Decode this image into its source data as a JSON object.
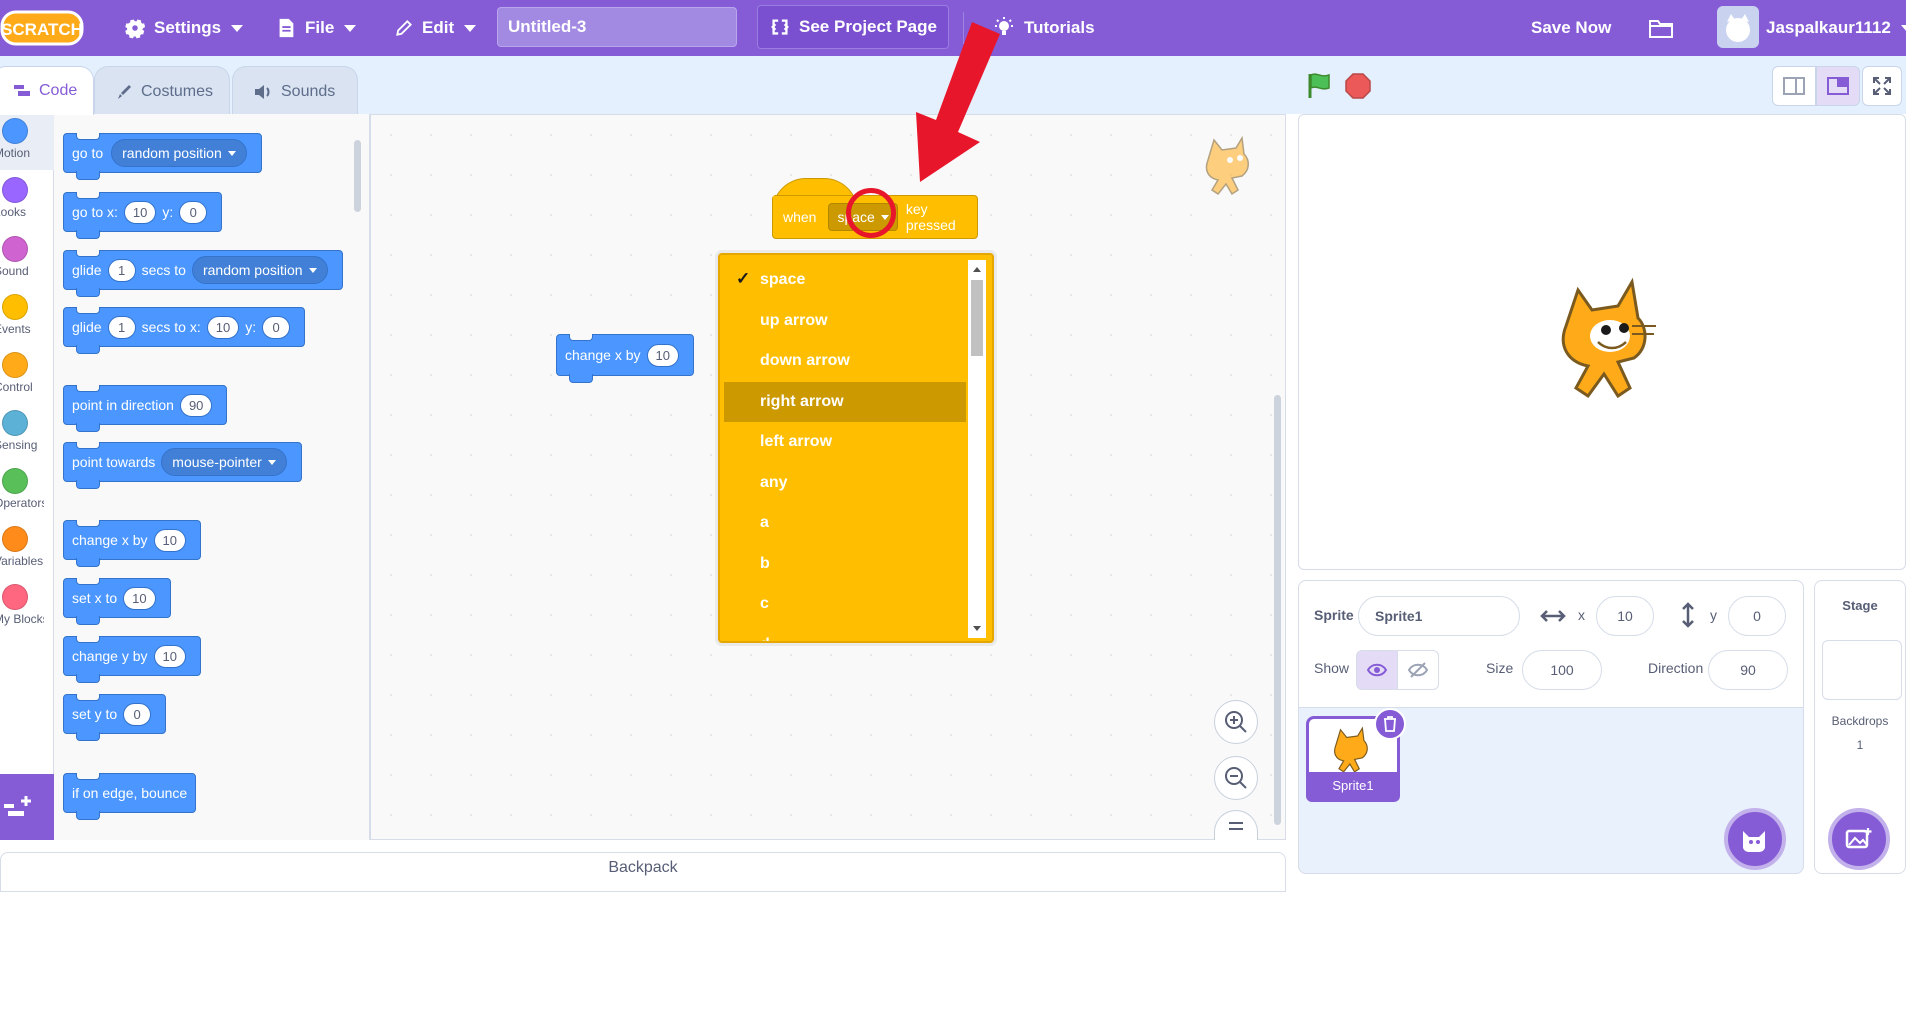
{
  "menubar": {
    "logo_text": "SCRATCH",
    "settings_label": "Settings",
    "file_label": "File",
    "edit_label": "Edit",
    "project_title": "Untitled-3",
    "see_project_label": "See Project Page",
    "tutorials_label": "Tutorials",
    "save_now_label": "Save Now",
    "username": "Jaspalkaur1112"
  },
  "tabs": [
    {
      "label": "Code"
    },
    {
      "label": "Costumes"
    },
    {
      "label": "Sounds"
    }
  ],
  "categories": [
    {
      "label": "Motion",
      "color": "#4c97ff"
    },
    {
      "label": "Looks",
      "color": "#9966ff"
    },
    {
      "label": "Sound",
      "color": "#cf63cf"
    },
    {
      "label": "Events",
      "color": "#ffbf00"
    },
    {
      "label": "Control",
      "color": "#ffab19"
    },
    {
      "label": "Sensing",
      "color": "#5cb1d6"
    },
    {
      "label": "Operators",
      "color": "#59c059"
    },
    {
      "label": "Variables",
      "color": "#ff8c1a"
    },
    {
      "label": "My Blocks",
      "color": "#ff6680"
    }
  ],
  "palette": {
    "goto_label": "go to",
    "goto_drop": "random position",
    "gotoxy_label": "go to x:",
    "gotoxy_x": "10",
    "gotoxy_ylabel": "y:",
    "gotoxy_y": "0",
    "glide_label": "glide",
    "glide_secs": "1",
    "glide_secs_to": "secs to",
    "glide_drop": "random position",
    "glidexy_label": "glide",
    "glidexy_secs": "1",
    "glidexy_secs_to": "secs to x:",
    "glidexy_x": "10",
    "glidexy_ylabel": "y:",
    "glidexy_y": "0",
    "point_dir_label": "point in direction",
    "point_dir_val": "90",
    "point_towards_label": "point towards",
    "point_towards_drop": "mouse-pointer",
    "change_x_label": "change x by",
    "change_x_val": "10",
    "set_x_label": "set x to",
    "set_x_val": "10",
    "change_y_label": "change y by",
    "change_y_val": "10",
    "set_y_label": "set y to",
    "set_y_val": "0",
    "bounce_label": "if on edge, bounce"
  },
  "code": {
    "hat_when": "when",
    "hat_key": "space",
    "hat_pressed": "key pressed",
    "loose_label": "change x by",
    "loose_val": "10"
  },
  "dropdown": {
    "items": [
      "space",
      "up arrow",
      "down arrow",
      "right arrow",
      "left arrow",
      "any",
      "a",
      "b",
      "c",
      "d"
    ],
    "selected": "space",
    "highlighted": "right arrow"
  },
  "backpack_label": "Backpack",
  "sprite_info": {
    "sprite_label": "Sprite",
    "sprite_name": "Sprite1",
    "x_label": "x",
    "x_val": "10",
    "y_label": "y",
    "y_val": "0",
    "show_label": "Show",
    "size_label": "Size",
    "size_val": "100",
    "direction_label": "Direction",
    "direction_val": "90"
  },
  "sprite_list": [
    {
      "name": "Sprite1"
    }
  ],
  "stage_pane": {
    "title": "Stage",
    "backdrops_label": "Backdrops",
    "backdrops_count": "1"
  },
  "colors": {
    "menubar": "#855cd6",
    "motion": "#4c97ff",
    "events": "#ffbf00",
    "annotation_red": "#e8162a"
  }
}
